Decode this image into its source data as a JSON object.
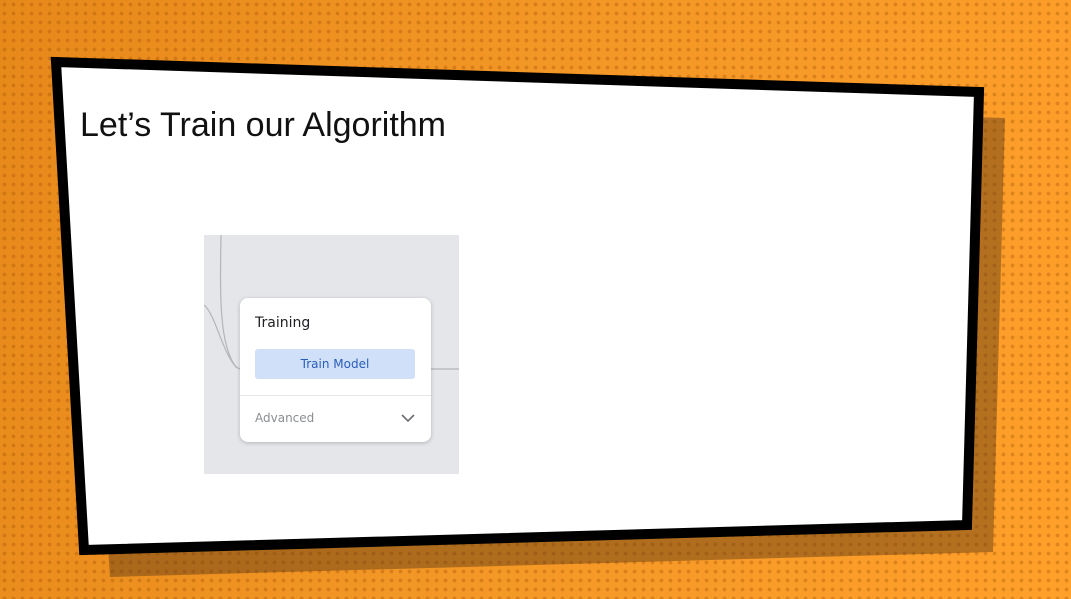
{
  "slide": {
    "title": "Let’s Train our Algorithm"
  },
  "card": {
    "title": "Training",
    "train_button_label": "Train Model",
    "advanced_label": "Advanced",
    "advanced_icon": "chevron-down-icon"
  },
  "colors": {
    "background_orange": "#f39a2a",
    "frame_border": "#000000",
    "shadow": "#8a5a2a",
    "panel_bg": "#e5e6ea",
    "button_bg": "#cfe0f8",
    "button_text": "#2a5db8"
  }
}
